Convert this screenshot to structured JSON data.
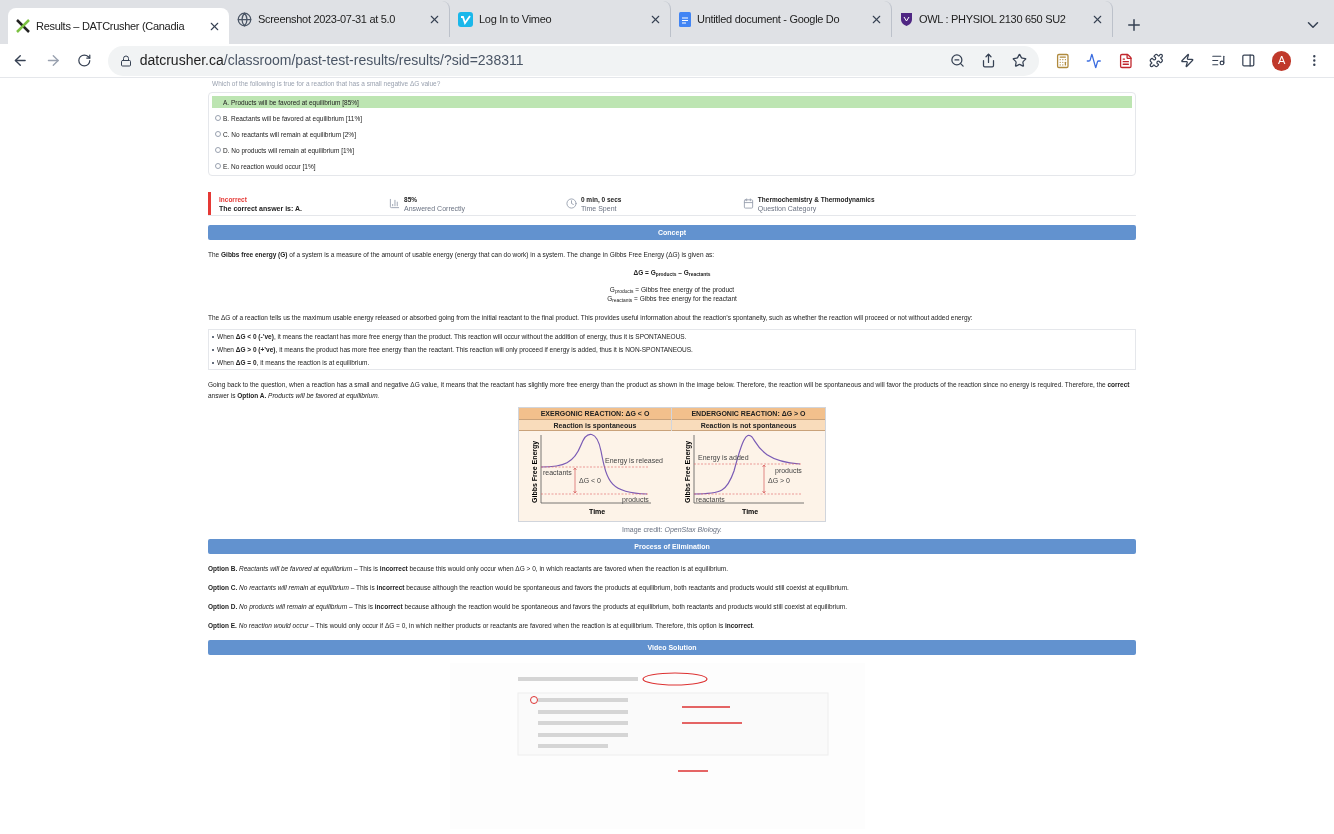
{
  "browser": {
    "tabs": [
      {
        "title": "Results – DATCrusher (Canadia",
        "kind": "x",
        "selected": true
      },
      {
        "title": "Screenshot 2023-07-31 at 5.0",
        "kind": "globe",
        "selected": false
      },
      {
        "title": "Log In to Vimeo",
        "kind": "vimeo",
        "selected": false
      },
      {
        "title": "Untitled document - Google Do",
        "kind": "docs",
        "selected": false
      },
      {
        "title": "OWL : PHYSIOL 2130 650 SU2",
        "kind": "shield",
        "selected": false
      }
    ],
    "address": {
      "domain": "datcrusher.ca",
      "path": "/classroom/past-test-results/results/?sid=238311"
    },
    "profile": "A"
  },
  "question": "Which of the following is true for a reaction that has a small negative ΔG value?",
  "options": [
    {
      "label": "A. Products will be favored at equilibrium [85%]",
      "selected": true
    },
    {
      "label": "B. Reactants will be favored at equilibrium [11%]",
      "selected": false
    },
    {
      "label": "C. No reactants will remain at equilibrium [2%]",
      "selected": false
    },
    {
      "label": "D. No products will remain at equilibrium [1%]",
      "selected": false
    },
    {
      "label": "E. No reaction would occur [1%]",
      "selected": false
    }
  ],
  "result": {
    "status": "Incorrect",
    "detail": "The correct answer is: A."
  },
  "stats": [
    {
      "kind": "chart",
      "value": "85%",
      "label": "Answered Correctly"
    },
    {
      "kind": "clock",
      "value": "0 min, 0 secs",
      "label": "Time Spent"
    },
    {
      "kind": "calendar",
      "value": "Thermochemistry & Thermodynamics",
      "label": "Question Category"
    }
  ],
  "concept": {
    "title": "Concept",
    "intro": "The **Gibbs free energy (G)** of a system is a measure of the amount of usable energy (energy that can do work) in a system. The change in Gibbs Free Energy (ΔG) is given as:",
    "formula": "ΔG = G$_{products}$ – G$_{reactants}$",
    "definitions": [
      "G$_{products}$ = Gibbs free energy of the product",
      "G$_{reactants}$ = Gibbs free energy for the reactant"
    ],
    "paragraph": "The ΔG of a reaction tells us the maximum usable energy released or absorbed going from the initial reactant to the final product. This provides useful information about the reaction’s spontaneity, such as whether the reaction will proceed or not without added energy:",
    "bullets": [
      "When **ΔG < 0 (-’ve)**, it means the reactant has more free energy than the product. This reaction will occur without the addition of energy, thus it is SPONTANEOUS.",
      "When **ΔG > 0 (+’ve)**, it means the product has more free energy than the reactant. This reaction will only proceed if energy is added, thus it is NON-SPONTANEOUS.",
      "When **ΔG = 0**, it means the reaction is at equilibrium."
    ],
    "conclusion": "Going back to the question, when a reaction has a small and negative ΔG value, it means that the reactant has slightly more free energy than the product as shown in the image below. Therefore, the reaction will be spontaneous and will favor the products of the reaction since no energy is required. Therefore, the **correct** answer is **Option A.** *Products will be favored at equilibrium.*"
  },
  "figure": {
    "panels": [
      {
        "kind": "exergonic",
        "title": "EXERGONIC REACTION: ΔG < O",
        "subtitle": "Reaction is spontaneous",
        "ylabel": "Gibbs Free Energy",
        "xlabel": "Time",
        "start_label": "reactants",
        "end_label": "products",
        "energy_label": "Energy is released",
        "delta_label": "ΔG < 0"
      },
      {
        "kind": "endergonic",
        "title": "ENDERGONIC REACTION: ΔG > O",
        "subtitle": "Reaction is not spontaneous",
        "ylabel": "Gibbs Free Energy",
        "xlabel": "Time",
        "start_label": "reactants",
        "end_label": "products",
        "energy_label": "Energy is added",
        "delta_label": "ΔG > 0"
      }
    ],
    "credit": "Image credit: *OpenStax Biology.*"
  },
  "elimination": {
    "title": "Process of Elimination",
    "items": [
      "**Option B.** *Reactants will be favored at equilibrium* – This is **incorrect** because this would only occur when ΔG  > 0, in which reactants are favored when the reaction is at equilibrium.",
      "**Option C.** *No reactants will remain at equilibrium* – This is **incorrect** because although the reaction would be spontaneous and favors the products at equilibrium, both reactants and products would still coexist at equilibrium.",
      "**Option D.** *No products will remain at equilibrium* – This is **incorrect** because although the reaction would be spontaneous and favors the products at equilibrium, both reactants and products would still coexist at equilibrium.",
      "**Option E.** *No reaction would occur* – This would only occur if ΔG = 0, in which neither products or reactants are favored when the reaction is at equilibrium. Therefore, this option is **incorrect**."
    ]
  },
  "video": {
    "title": "Video Solution"
  }
}
